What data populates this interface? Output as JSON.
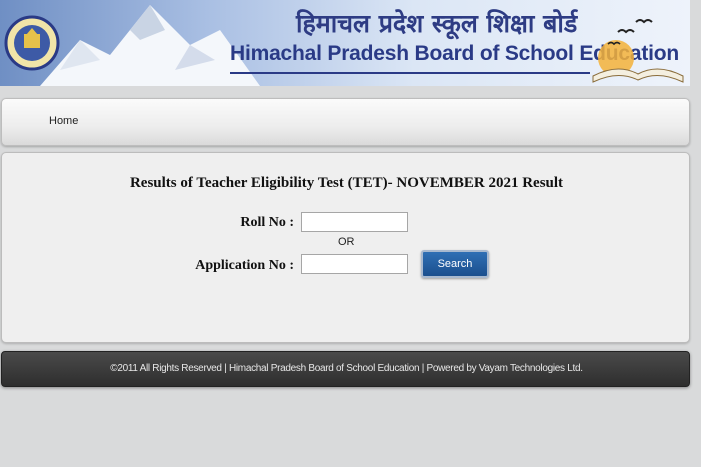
{
  "header": {
    "title_hindi": "हिमाचल प्रदेश स्कूल शिक्षा बोर्ड",
    "title_english": "Himachal Pradesh Board of School Education"
  },
  "nav": {
    "home_label": "Home"
  },
  "form": {
    "title": "Results of Teacher Eligibility Test (TET)- NOVEMBER 2021 Result",
    "roll_label": "Roll No :",
    "roll_value": "",
    "or_label": "OR",
    "application_label": "Application No :",
    "application_value": "",
    "search_label": "Search"
  },
  "footer": {
    "text": "©2011 All Rights Reserved | Himachal Pradesh Board of School Education | Powered by Vayam Technologies Ltd."
  },
  "colors": {
    "title_blue": "#2a3a86",
    "button_blue": "#1b4f8e",
    "footer_bg": "#333333"
  }
}
